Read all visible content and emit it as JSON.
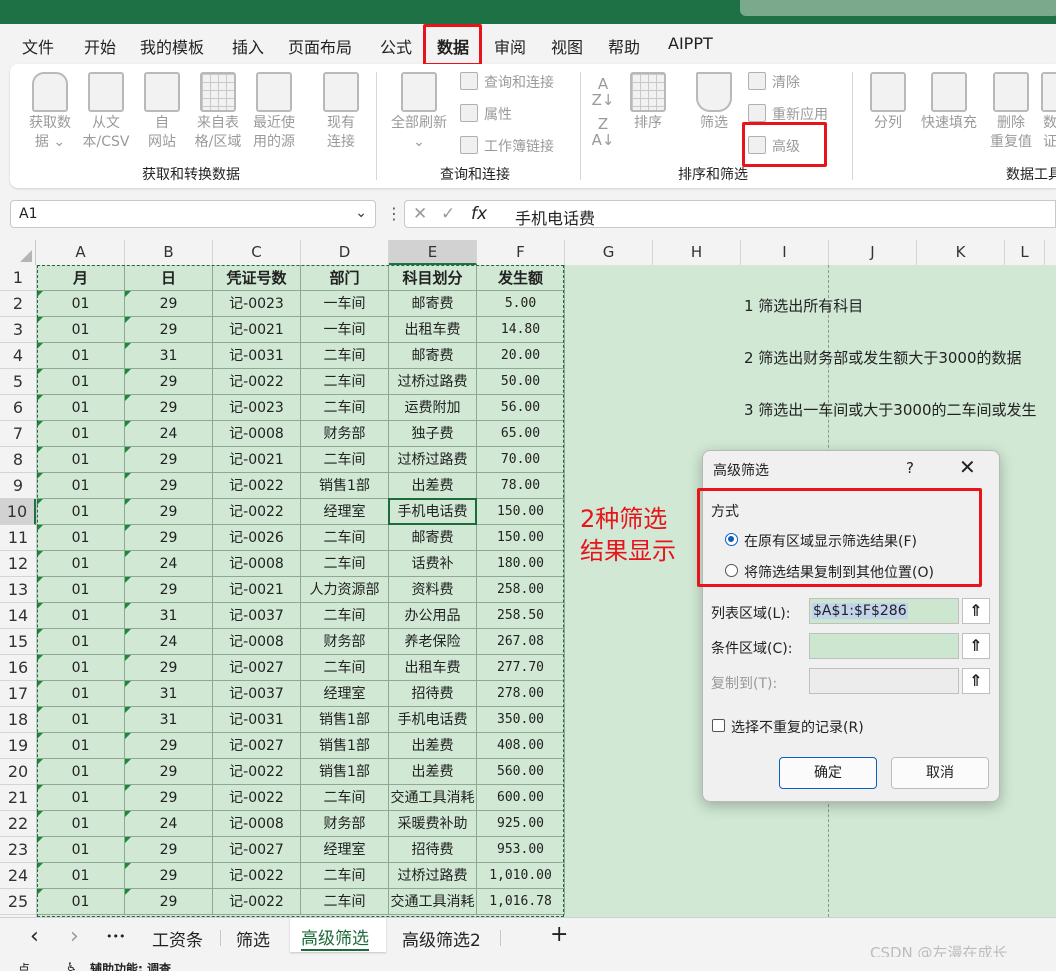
{
  "menu": {
    "tabs": [
      "文件",
      "开始",
      "我的模板",
      "插入",
      "页面布局",
      "公式",
      "数据",
      "审阅",
      "视图",
      "帮助",
      "AIPPT"
    ],
    "active_index": 6
  },
  "ribbon": {
    "get_data": "获取数\n据 ⌄",
    "from_text": "从文\n本/CSV",
    "from_web": "自\n网站",
    "from_table": "来自表\n格/区域",
    "recent_sources": "最近使\n用的源",
    "existing_conn": "现有\n连接",
    "group_get_transform": "获取和转换数据",
    "refresh_all": "全部刷新\n⌄",
    "queries_conn": "查询和连接",
    "properties": "属性",
    "workbook_links": "工作簿链接",
    "group_queries": "查询和连接",
    "sort": "排序",
    "filter": "筛选",
    "clear": "清除",
    "reapply": "重新应用",
    "advanced": "高级",
    "group_sort_filter": "排序和筛选",
    "split": "分列",
    "flash_fill": "快速填充",
    "remove_dup": "删除\n重复值",
    "data_validation": "数\n证",
    "group_data_tools": "数据工具"
  },
  "formula_bar": {
    "name_box": "A1",
    "cancel_icon": "✕",
    "enter_icon": "✓",
    "fx": "fx",
    "value": "手机电话费"
  },
  "columns": [
    "A",
    "B",
    "C",
    "D",
    "E",
    "F",
    "G",
    "H",
    "I",
    "J",
    "K",
    "L"
  ],
  "selected_column": "E",
  "selected_row": 10,
  "table": {
    "headers": [
      "月",
      "日",
      "凭证号数",
      "部门",
      "科目划分",
      "发生额"
    ],
    "rows": [
      [
        "01",
        "29",
        "记-0023",
        "一车间",
        "邮寄费",
        "5.00"
      ],
      [
        "01",
        "29",
        "记-0021",
        "一车间",
        "出租车费",
        "14.80"
      ],
      [
        "01",
        "31",
        "记-0031",
        "二车间",
        "邮寄费",
        "20.00"
      ],
      [
        "01",
        "29",
        "记-0022",
        "二车间",
        "过桥过路费",
        "50.00"
      ],
      [
        "01",
        "29",
        "记-0023",
        "二车间",
        "运费附加",
        "56.00"
      ],
      [
        "01",
        "24",
        "记-0008",
        "财务部",
        "独子费",
        "65.00"
      ],
      [
        "01",
        "29",
        "记-0021",
        "二车间",
        "过桥过路费",
        "70.00"
      ],
      [
        "01",
        "29",
        "记-0022",
        "销售1部",
        "出差费",
        "78.00"
      ],
      [
        "01",
        "29",
        "记-0022",
        "经理室",
        "手机电话费",
        "150.00"
      ],
      [
        "01",
        "29",
        "记-0026",
        "二车间",
        "邮寄费",
        "150.00"
      ],
      [
        "01",
        "24",
        "记-0008",
        "二车间",
        "话费补",
        "180.00"
      ],
      [
        "01",
        "29",
        "记-0021",
        "人力资源部",
        "资料费",
        "258.00"
      ],
      [
        "01",
        "31",
        "记-0037",
        "二车间",
        "办公用品",
        "258.50"
      ],
      [
        "01",
        "24",
        "记-0008",
        "财务部",
        "养老保险",
        "267.08"
      ],
      [
        "01",
        "29",
        "记-0027",
        "二车间",
        "出租车费",
        "277.70"
      ],
      [
        "01",
        "31",
        "记-0037",
        "经理室",
        "招待费",
        "278.00"
      ],
      [
        "01",
        "31",
        "记-0031",
        "销售1部",
        "手机电话费",
        "350.00"
      ],
      [
        "01",
        "29",
        "记-0027",
        "销售1部",
        "出差费",
        "408.00"
      ],
      [
        "01",
        "29",
        "记-0022",
        "销售1部",
        "出差费",
        "560.00"
      ],
      [
        "01",
        "29",
        "记-0022",
        "二车间",
        "交通工具消耗",
        "600.00"
      ],
      [
        "01",
        "24",
        "记-0008",
        "财务部",
        "采暖费补助",
        "925.00"
      ],
      [
        "01",
        "29",
        "记-0027",
        "经理室",
        "招待费",
        "953.00"
      ],
      [
        "01",
        "29",
        "记-0022",
        "二车间",
        "过桥过路费",
        "1,010.00"
      ],
      [
        "01",
        "29",
        "记-0022",
        "二车间",
        "交通工具消耗",
        "1,016.78"
      ]
    ]
  },
  "notes": [
    "1  筛选出所有科目",
    "2  筛选出财务部或发生额大于3000的数据",
    "3  筛选出一车间或大于3000的二车间或发生"
  ],
  "annotation": {
    "line1": "2种筛选",
    "line2": "结果显示",
    "color": "#e8141b"
  },
  "dialog": {
    "title": "高级筛选",
    "help": "?",
    "close": "✕",
    "mode_label": "方式",
    "option1": "在原有区域显示筛选结果(F)",
    "option2": "将筛选结果复制到其他位置(O)",
    "list_range_label": "列表区域(L):",
    "list_range_value": "$A$1:$F$286",
    "criteria_label": "条件区域(C):",
    "criteria_value": "",
    "copy_to_label": "复制到(T):",
    "unique_label": "选择不重复的记录(R)",
    "ok": "确定",
    "cancel": "取消"
  },
  "sheet_tabs": {
    "nav_prev": "‹",
    "nav_next": "›",
    "more": "•••",
    "tabs": [
      "工资条",
      "筛选",
      "高级筛选",
      "高级筛选2"
    ],
    "active_index": 2,
    "add": "+"
  },
  "status": {
    "left": "点",
    "accessibility": "辅助功能: 调查"
  },
  "watermark": "CSDN @左漫在成长",
  "colors": {
    "excel_green": "#1e7145",
    "cell_green": "#d0e8d4",
    "highlight_red": "#e8141b"
  }
}
